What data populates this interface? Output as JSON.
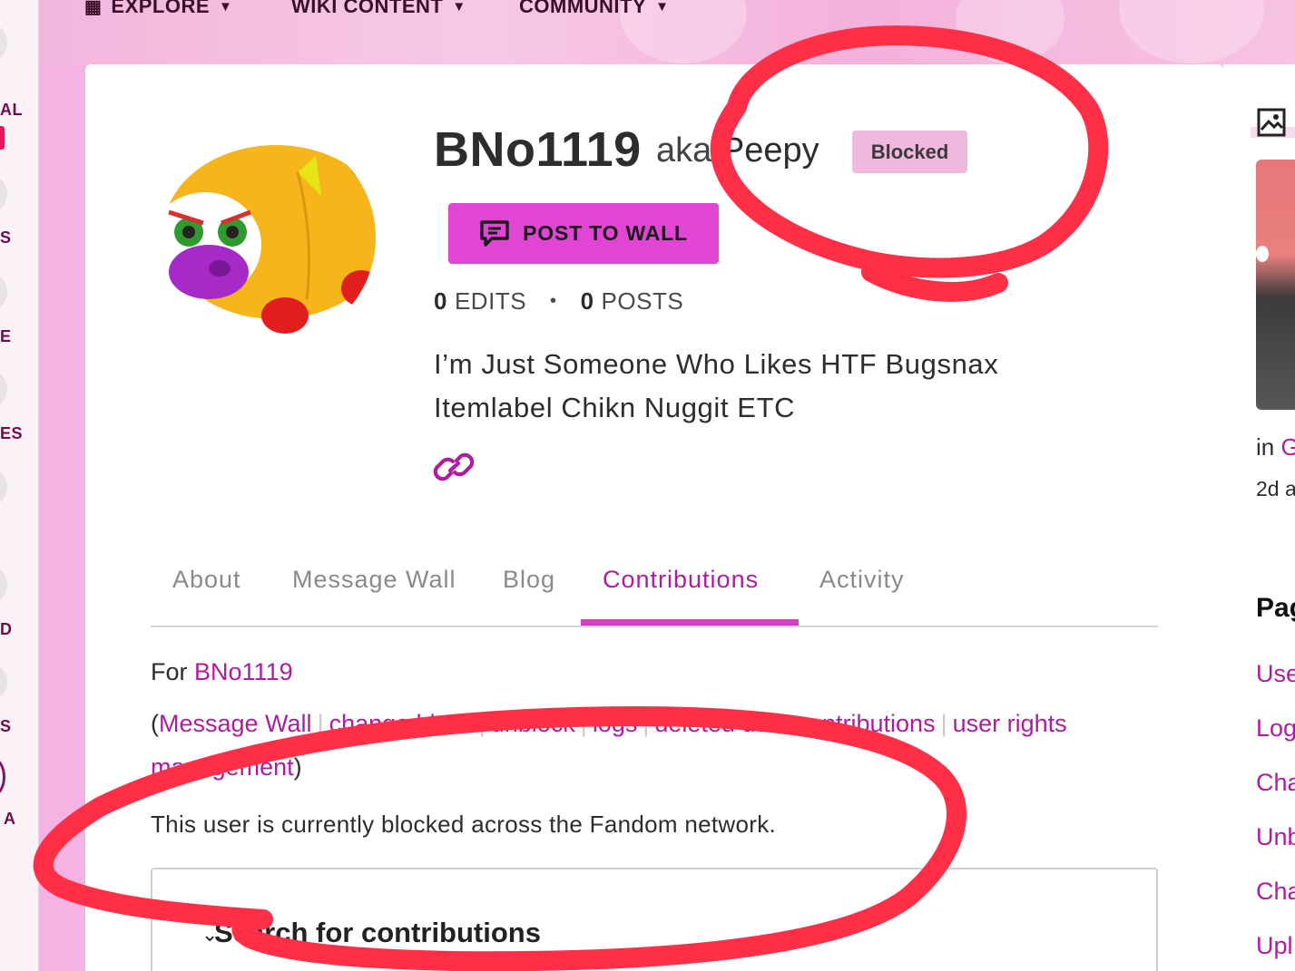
{
  "nav": {
    "explore": "EXPLORE",
    "wiki_content": "WIKI CONTENT",
    "community": "COMMUNITY"
  },
  "left_rail": {
    "labels": [
      "AL",
      "S",
      "E",
      "ES",
      "D",
      "S",
      "A"
    ]
  },
  "profile": {
    "username": "BNo1119",
    "aka_word": "aka",
    "aka_name": "Peepy",
    "status_badge": "Blocked",
    "post_button": "POST TO WALL",
    "edits_count": "0",
    "edits_label": "EDITS",
    "posts_count": "0",
    "posts_label": "POSTS",
    "bio_line1": "I’m Just Someone Who Likes HTF Bugsnax",
    "bio_line2": "Itemlabel Chikn Nuggit ETC"
  },
  "tabs": [
    "About",
    "Message Wall",
    "Blog",
    "Contributions",
    "Activity"
  ],
  "contributions": {
    "for_prefix": "For",
    "for_user": "BNo1119",
    "links": {
      "message_wall": "Message Wall",
      "change_block": "change block",
      "unblock": "unblock",
      "logs": "logs",
      "deleted_user": "deleted user",
      "contributions": "contributions",
      "user_rights": "user rights management"
    },
    "notice": "This user is currently blocked across the Fandom network.",
    "search_title": "Search for contributions"
  },
  "right_rail": {
    "in_prefix": "in",
    "in_link": "G",
    "time": "2d a",
    "heading": "Pag",
    "links": [
      "Use",
      "Log",
      "Cha",
      "Unb",
      "Cha",
      "Upl"
    ]
  },
  "colors": {
    "accent": "#b01ca0",
    "button": "#e045d4",
    "badge": "#eeb9dd",
    "annotation": "#ff2f47",
    "background": "#f4b3e2"
  }
}
